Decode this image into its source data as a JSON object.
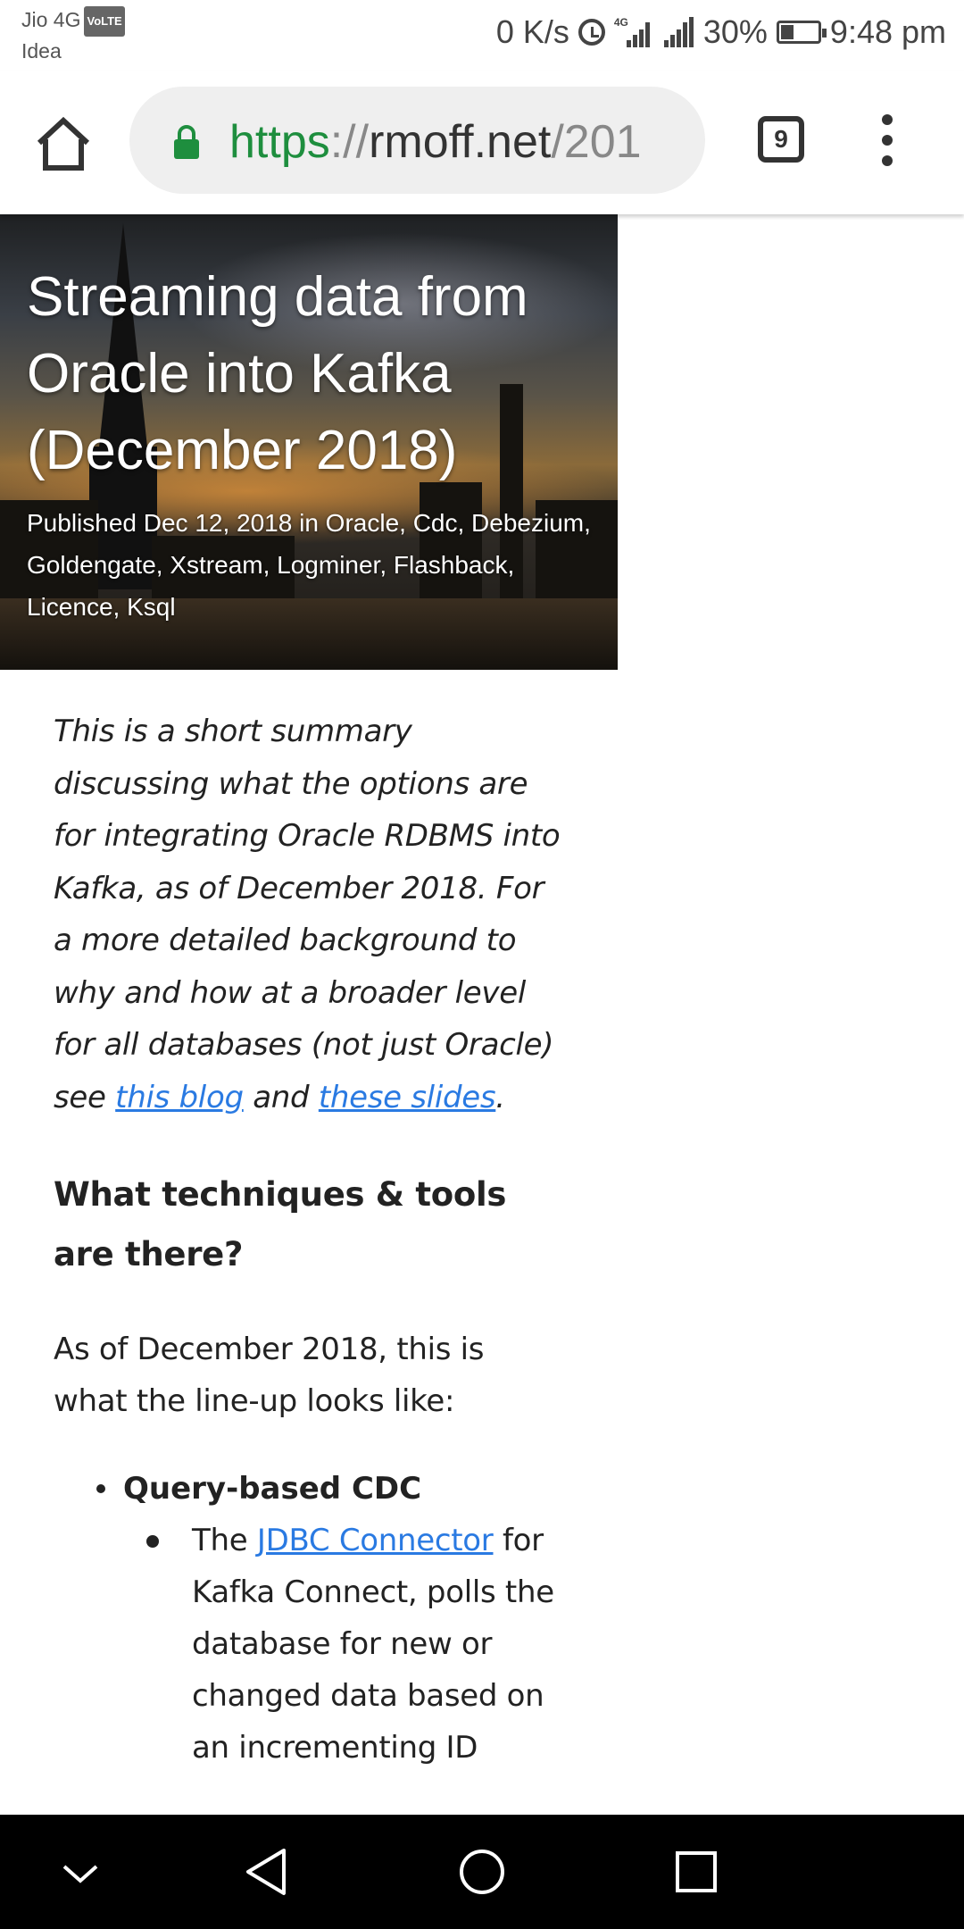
{
  "status_bar": {
    "carrier1": "Jio 4G",
    "volte": "VoLTE",
    "carrier2": "Idea",
    "net_speed": "0 K/s",
    "battery": "30%",
    "time": "9:48 pm",
    "icons": [
      "alarm-icon",
      "signal-4g-icon",
      "signal-icon",
      "battery-icon"
    ]
  },
  "browser": {
    "url_scheme": "https",
    "url_sep": "://",
    "url_host": "rmoff.net",
    "url_path": "/201",
    "tab_count": "9",
    "scheme_color": "#1e8e3e"
  },
  "hero": {
    "title": "Streaming data from Oracle into Kafka (December 2018)",
    "meta": "Published Dec 12, 2018 in Oracle, Cdc, Debezium, Goldengate, Xstream, Logminer, Flashback, Licence, Ksql"
  },
  "article": {
    "summary_pre": "This is a short summary discussing what the options are for integrating Oracle RDBMS into Kafka, as of December 2018. For a more detailed background to why and how at a broader level for all databases (not just Oracle) see ",
    "link1": "this blog",
    "summary_mid": " and ",
    "link2": "these slides",
    "summary_post": ".",
    "heading": "What techniques & tools are there?",
    "intro": "As of December 2018, this is what the line-up looks like:",
    "list": {
      "item1_label": "Query-based CDC",
      "sub1_pre": "The ",
      "sub1_link": "JDBC Connector",
      "sub1_post": " for Kafka Connect, polls the database for new or changed data based on an incrementing ID"
    },
    "link_color": "#2a7ae2"
  },
  "nav_bar": {
    "buttons": [
      "collapse-icon",
      "back-icon",
      "home-icon",
      "recents-icon"
    ]
  }
}
